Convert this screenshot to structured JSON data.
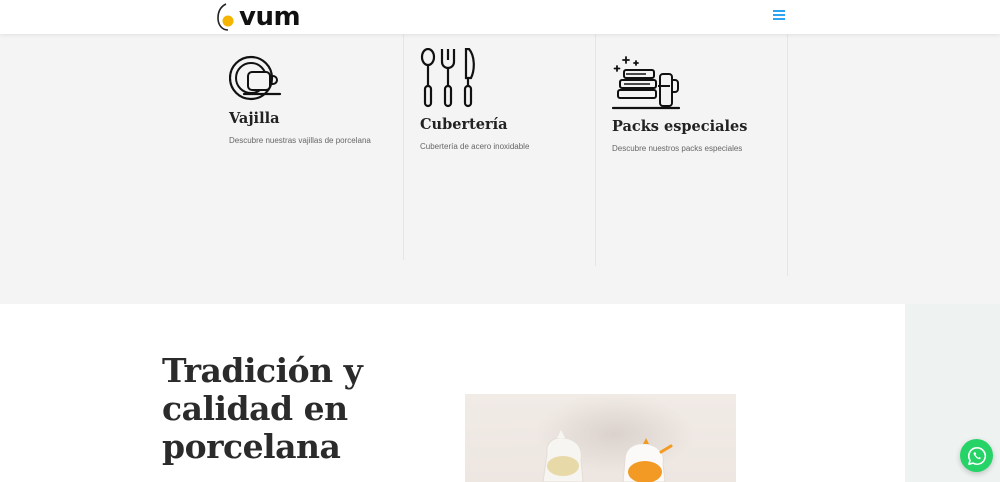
{
  "header": {
    "logo_text": "vum",
    "colors": {
      "accent": "#2ea3f2",
      "logo_dot": "#f5b400"
    }
  },
  "categories": [
    {
      "icon": "dinnerware-icon",
      "title": "Vajilla",
      "description": "Descubre nuestras vajillas de porcelana"
    },
    {
      "icon": "cutlery-icon",
      "title": "Cubertería",
      "description": "Cubertería de acero inoxidable"
    },
    {
      "icon": "special-packs-icon",
      "title": "Packs especiales",
      "description": "Descubre nuestros packs especiales"
    }
  ],
  "tradition": {
    "heading_lines": [
      "Tradición y",
      "calidad en",
      "porcelana"
    ]
  },
  "whatsapp": {
    "icon": "whatsapp-icon",
    "color": "#25d366"
  }
}
